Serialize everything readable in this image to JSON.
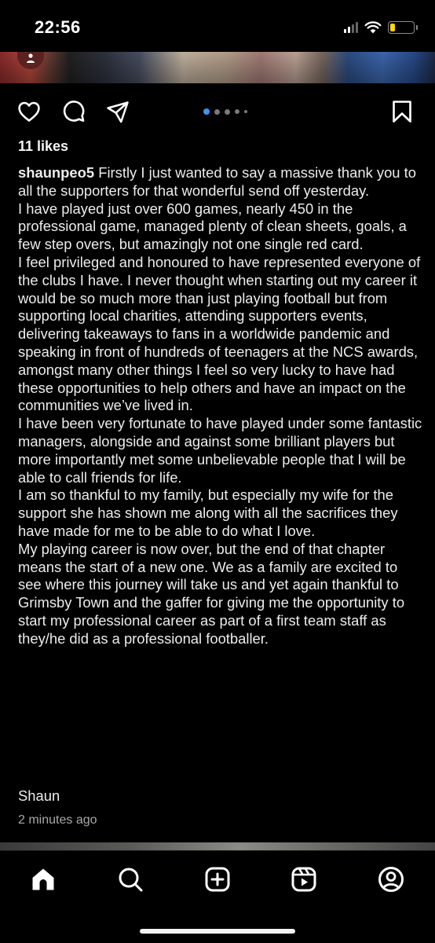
{
  "status_bar": {
    "time": "22:56",
    "battery_level": 0.2,
    "battery_color": "#ffd60a",
    "signal_bars_active": 2,
    "signal_bars_total": 4
  },
  "post": {
    "likes": "11 likes",
    "username": "shaunpeo5",
    "carousel": {
      "count": 5,
      "active_index": 0,
      "active_color": "#3897f0"
    },
    "caption_paragraphs": [
      "Firstly I just wanted to say a massive thank you to all the supporters for that wonderful send off yesterday.",
      "I have played just over 600 games, nearly 450 in the professional game, managed plenty of clean sheets, goals, a few step overs, but amazingly not one single red card.",
      "I feel privileged and honoured to have represented everyone of the clubs I have. I never thought when starting out my career it would be so much more than just playing football but from supporting local charities, attending supporters events, delivering takeaways to fans in a worldwide pandemic and speaking in front of hundreds of teenagers at the NCS awards, amongst many other things I feel so very lucky to have had these opportunities to help others and have an impact on the communities we’ve lived in.",
      "I have been very fortunate to have played under some fantastic managers, alongside and against some brilliant players but more importantly met some unbelievable people that I will be able to call friends for life.",
      "I am so thankful to my family, but especially my wife for the support she has shown me along with all the sacrifices they have made for me to be able to do what I love.",
      "My playing career is now over, but the end of that chapter means the start of a new one. We as a family are excited to see where this journey will take us and yet again thankful to Grimsby Town and the gaffer for giving me the opportunity to start my professional career as part of a first team staff as they/he did as a professional footballer."
    ],
    "signoff": "Shaun",
    "timestamp": "2 minutes ago"
  },
  "icons": {
    "actions": [
      "heart-icon",
      "comment-icon",
      "share-icon",
      "bookmark-icon"
    ],
    "tabs": [
      "home-icon",
      "search-icon",
      "create-icon",
      "reels-icon",
      "profile-icon"
    ]
  },
  "colors": {
    "background": "#000000",
    "text": "#f5f5f5",
    "muted": "#a8a8a8"
  }
}
